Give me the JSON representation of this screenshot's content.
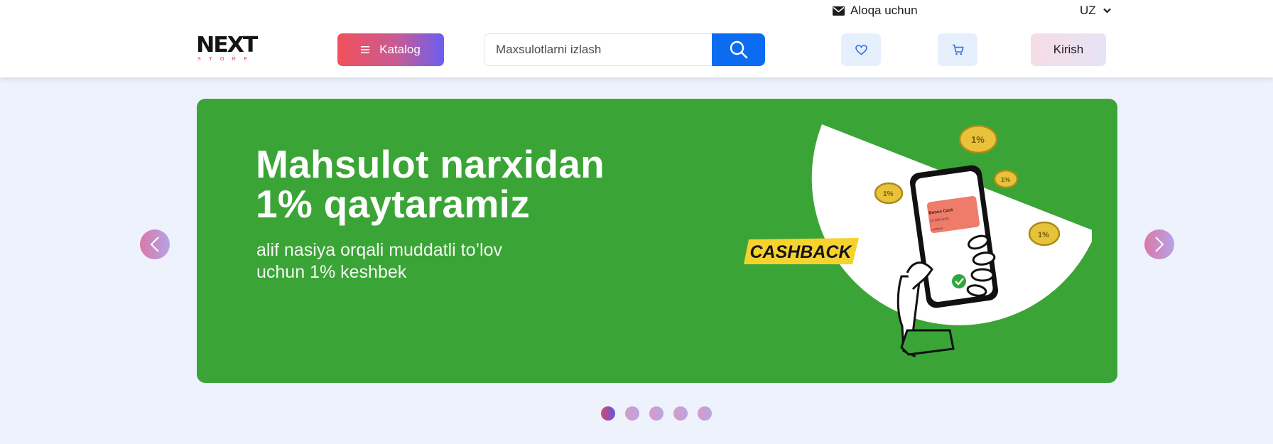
{
  "topbar": {
    "contact_label": "Aloqa uchun",
    "language": "UZ"
  },
  "header": {
    "logo_text": "NEXT",
    "logo_sub": "STORE",
    "catalog_label": "Katalog",
    "search_placeholder": "Maxsulotlarni izlash",
    "login_label": "Kirish"
  },
  "banner": {
    "title_line1": "Mahsulot narxidan",
    "title_line2": "1% qaytaramiz",
    "subtitle_line1": "alif nasiya orqali muddatli to’lov",
    "subtitle_line2": "uchun 1% keshbek",
    "tag": "CASHBACK",
    "card_title": "Bonus Card",
    "card_amount": "12 000 so'm",
    "card_name": "cashback",
    "coin_text": "1%",
    "background": "#3aa536"
  },
  "carousel": {
    "slides": 5,
    "active_index": 0
  },
  "colors": {
    "search_button": "#0b6cf2",
    "icon_button_bg": "#e6effc",
    "page_bg": "#eef2fd"
  }
}
